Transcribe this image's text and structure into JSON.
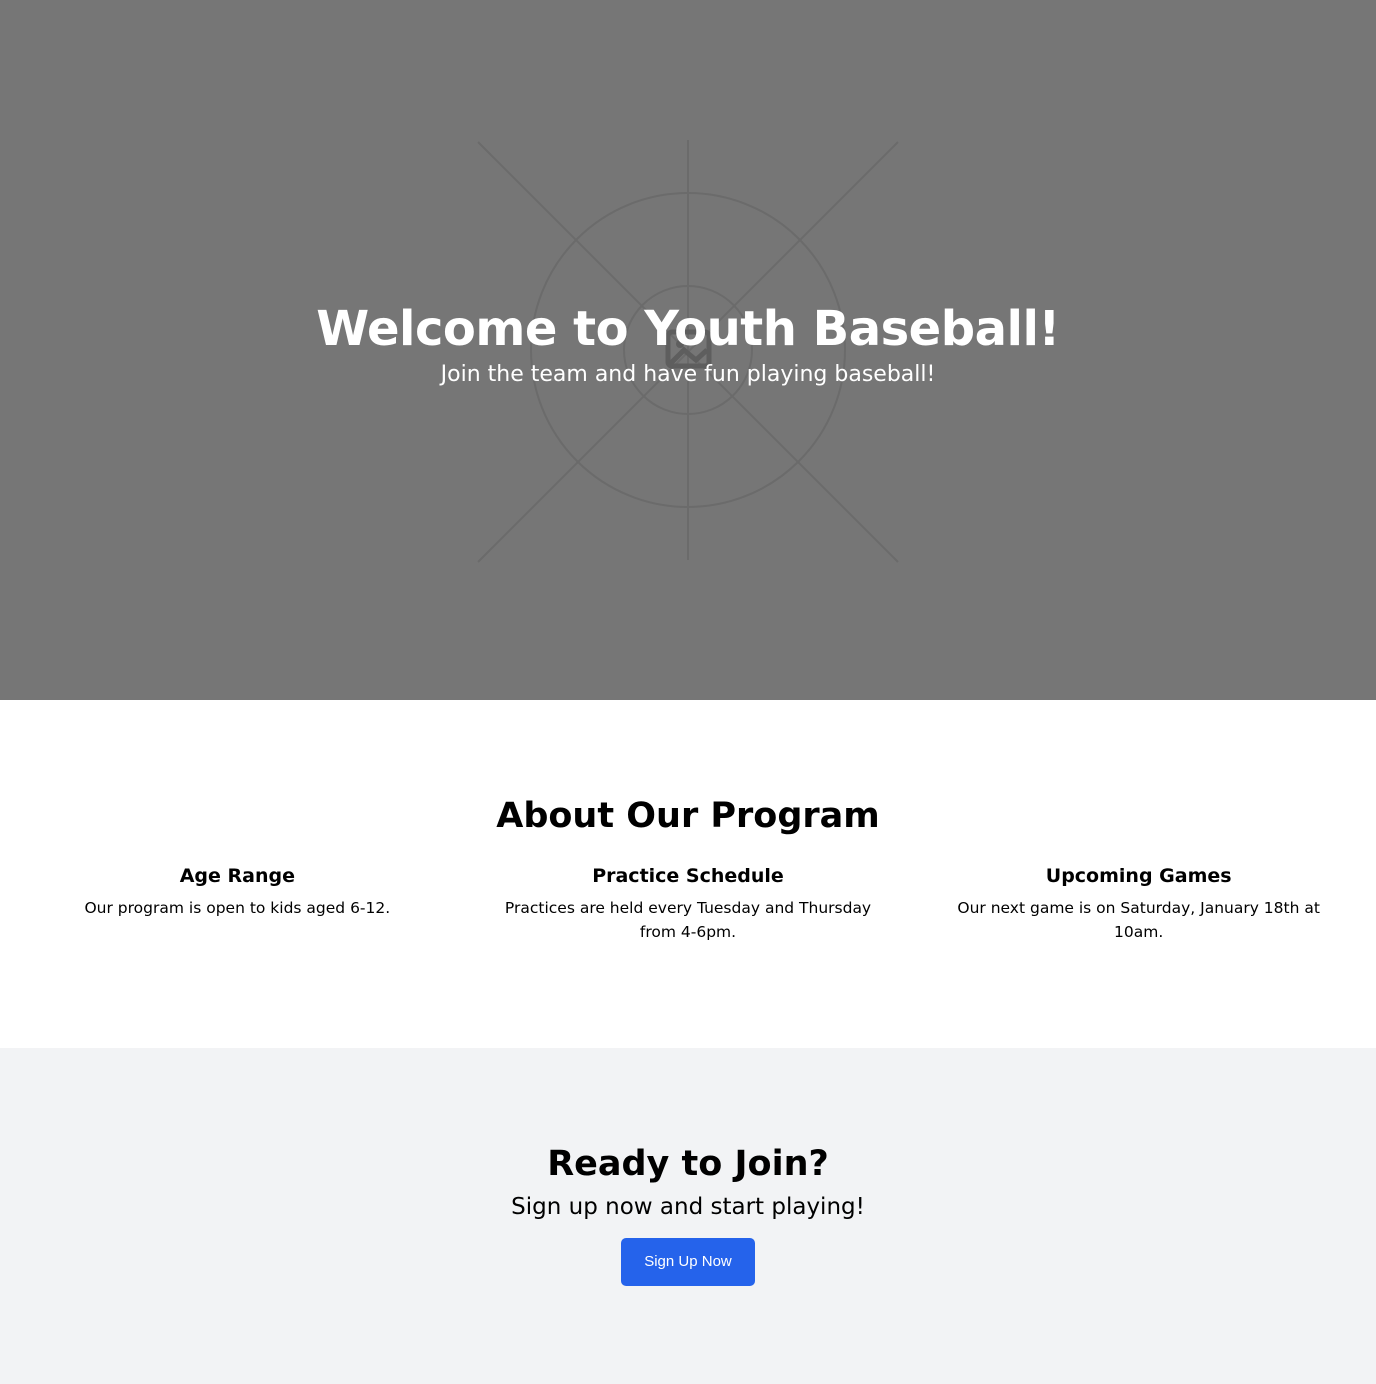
{
  "hero": {
    "title": "Welcome to Youth Baseball!",
    "subtitle": "Join the team and have fun playing baseball!",
    "background_color": "#767676",
    "image_icon": "image-placeholder-icon"
  },
  "about": {
    "title": "About Our Program",
    "features": [
      {
        "title": "Age Range",
        "text": "Our program is open to kids aged 6-12."
      },
      {
        "title": "Practice Schedule",
        "text": "Practices are held every Tuesday and Thursday from 4-6pm."
      },
      {
        "title": "Upcoming Games",
        "text": "Our next game is on Saturday, January 18th at 10am."
      }
    ]
  },
  "cta": {
    "title": "Ready to Join?",
    "subtitle": "Sign up now and start playing!",
    "button_label": "Sign Up Now",
    "button_color": "#2563eb",
    "background_color": "#f2f3f5"
  }
}
